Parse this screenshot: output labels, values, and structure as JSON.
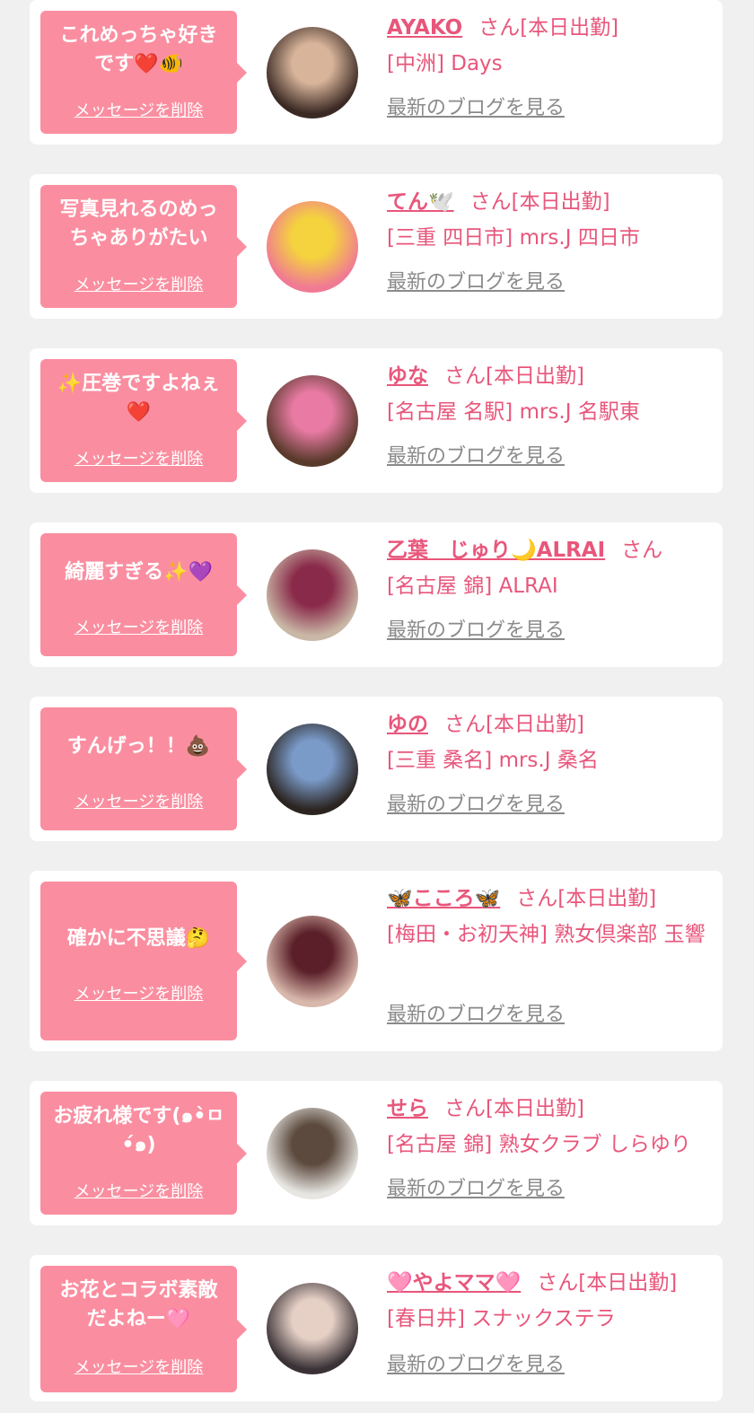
{
  "delete_label": "メッセージを削除",
  "blog_label": "最新のブログを見る",
  "colors": {
    "background": "#f0f0f0",
    "bubble": "#fa8ea0",
    "name_text": "#e8567b",
    "link_gray": "#8a8a8a"
  },
  "items": [
    {
      "message": "これめっちゃ好き\nです❤️🐠",
      "name": "AYAKO",
      "suffix": "さん[本日出勤]",
      "shop": "[中洲] Days",
      "avatar_colors": [
        "#3b2a24",
        "#d8b49a"
      ]
    },
    {
      "message": "写真見れるのめっ\nちゃありがたい",
      "name": "てん🕊️",
      "suffix": "さん[本日出勤]",
      "shop": "[三重 四日市] mrs.J 四日市",
      "avatar_colors": [
        "#f07a93",
        "#f4d33e"
      ]
    },
    {
      "message": "✨圧巻ですよねぇ\n❤️",
      "name": "ゆな",
      "suffix": "さん[本日出勤]",
      "shop": "[名古屋 名駅] mrs.J 名駅東",
      "avatar_colors": [
        "#5a3a2c",
        "#e87aa3"
      ]
    },
    {
      "message": "綺麗すぎる✨💜",
      "name": "乙葉　じゅり🌙ALRAI",
      "suffix": "さん",
      "shop": "[名古屋 錦] ALRAI",
      "avatar_colors": [
        "#c9b8a6",
        "#8a2a4a"
      ]
    },
    {
      "message": "すんげっ！！💩",
      "name": "ゆの",
      "suffix": "さん[本日出勤]",
      "shop": "[三重 桑名] mrs.J 桑名",
      "avatar_colors": [
        "#2b2420",
        "#7a9ac8"
      ]
    },
    {
      "message": "確かに不思議🤔",
      "name": "🦋こころ🦋",
      "suffix": "さん[本日出勤]",
      "shop": "[梅田・お初天神] 熟女倶楽部 玉響",
      "avatar_colors": [
        "#d9b8ac",
        "#5a1f28"
      ]
    },
    {
      "message": "お疲れ様です(๑•̀ㅁ\n•́๑)",
      "name": "せら",
      "suffix": "さん[本日出勤]",
      "shop": "[名古屋 錦] 熟女クラブ しらゆり",
      "avatar_colors": [
        "#e8e6e2",
        "#5c4a3e"
      ]
    },
    {
      "message": "お花とコラボ素敵\nだよねー🩷",
      "name": "🩷やよママ🩷",
      "suffix": "さん[本日出勤]",
      "shop": "[春日井] スナックステラ",
      "avatar_colors": [
        "#3a3236",
        "#e6d0c6"
      ]
    }
  ]
}
